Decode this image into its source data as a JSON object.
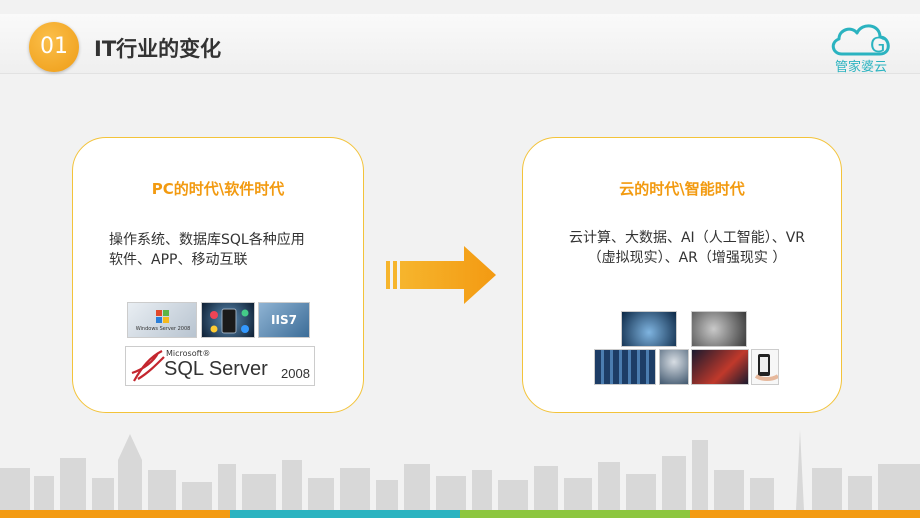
{
  "header": {
    "number": "01",
    "title": "IT行业的变化",
    "logo_letter": "G",
    "logo_text": "管家婆云"
  },
  "left_card": {
    "title": "PC的时代\\软件时代",
    "description": "操作系统、数据库SQL各种应用\n软件、APP、移动互联",
    "images": {
      "windows_server_caption": "Windows Server 2008",
      "iis_label": "IIS7",
      "sql_server_small": "Microsoft®",
      "sql_server_main": "SQL Server",
      "sql_server_year": "2008"
    }
  },
  "right_card": {
    "title": "云的时代\\智能时代",
    "description": "云计算、大数据、AI（人工智能）、VR\n（虚拟现实）、AR（增强现实 ）"
  },
  "colors": {
    "accent_orange": "#f29a10",
    "card_border": "#f3c33a",
    "logo_teal": "#2bb3c0"
  }
}
